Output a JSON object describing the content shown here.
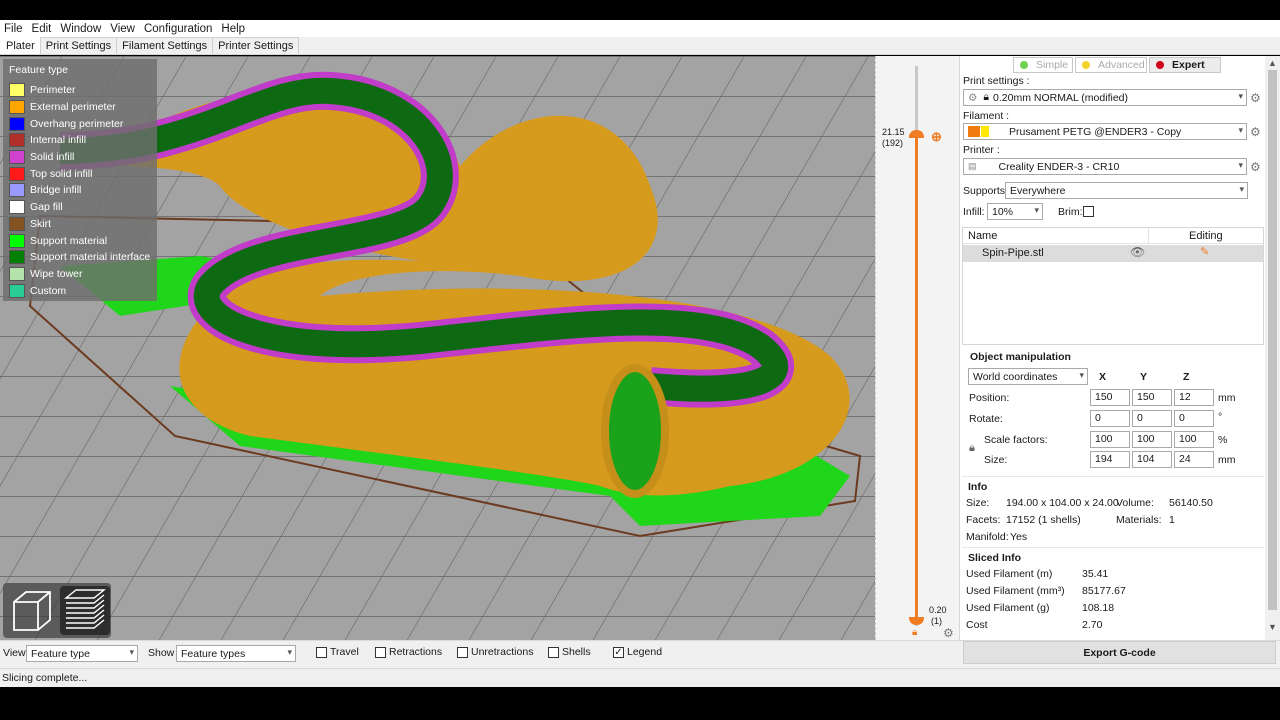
{
  "menu": [
    "File",
    "Edit",
    "Window",
    "View",
    "Configuration",
    "Help"
  ],
  "tabs": [
    "Plater",
    "Print Settings",
    "Filament Settings",
    "Printer Settings"
  ],
  "legend": {
    "title": "Feature type",
    "items": [
      {
        "label": "Perimeter",
        "color": "#ffff66"
      },
      {
        "label": "External perimeter",
        "color": "#ffa500"
      },
      {
        "label": "Overhang perimeter",
        "color": "#0000ff"
      },
      {
        "label": "Internal infill",
        "color": "#b03029"
      },
      {
        "label": "Solid infill",
        "color": "#d041d0"
      },
      {
        "label": "Top solid infill",
        "color": "#ff1a1a"
      },
      {
        "label": "Bridge infill",
        "color": "#9999ff"
      },
      {
        "label": "Gap fill",
        "color": "#ffffff"
      },
      {
        "label": "Skirt",
        "color": "#845321"
      },
      {
        "label": "Support material",
        "color": "#00ff00"
      },
      {
        "label": "Support material interface",
        "color": "#008000"
      },
      {
        "label": "Wipe tower",
        "color": "#b3e3ab"
      },
      {
        "label": "Custom",
        "color": "#28cc94"
      }
    ]
  },
  "slider": {
    "top_value": "21.15",
    "top_layer": "(192)",
    "bottom_value": "0.20",
    "bottom_layer": "(1)"
  },
  "modes": [
    {
      "label": "Simple",
      "color": "#6fd24e"
    },
    {
      "label": "Advanced",
      "color": "#f2d32c"
    },
    {
      "label": "Expert",
      "color": "#d2001a"
    }
  ],
  "print_settings": {
    "label": "Print settings :",
    "value": "0.20mm NORMAL (modified)"
  },
  "filament": {
    "label": "Filament :",
    "value": "Prusament PETG @ENDER3 - Copy"
  },
  "printer": {
    "label": "Printer :",
    "value": "Creality ENDER-3 - CR10"
  },
  "supports": {
    "label": "Supports:",
    "value": "Everywhere"
  },
  "infill": {
    "label": "Infill:",
    "value": "10%"
  },
  "brim": {
    "label": "Brim:"
  },
  "object_list": {
    "col_name": "Name",
    "col_editing": "Editing",
    "items": [
      "Spin-Pipe.stl"
    ]
  },
  "object_manipulation": {
    "title": "Object manipulation",
    "coords": "World coordinates",
    "axes": [
      "X",
      "Y",
      "Z"
    ],
    "position": {
      "label": "Position:",
      "values": [
        "150",
        "150",
        "12"
      ],
      "unit": "mm"
    },
    "rotate": {
      "label": "Rotate:",
      "values": [
        "0",
        "0",
        "0"
      ],
      "unit": "°"
    },
    "scale": {
      "label": "Scale factors:",
      "values": [
        "100",
        "100",
        "100"
      ],
      "unit": "%"
    },
    "size": {
      "label": "Size:",
      "values": [
        "194",
        "104",
        "24"
      ],
      "unit": "mm"
    }
  },
  "info": {
    "title": "Info",
    "size_label": "Size:",
    "size_value": "194.00 x 104.00 x 24.00",
    "volume_label": "Volume:",
    "volume_value": "56140.50",
    "facets_label": "Facets:",
    "facets_value": "17152 (1 shells)",
    "materials_label": "Materials:",
    "materials_value": "1",
    "manifold_label": "Manifold:",
    "manifold_value": "Yes"
  },
  "sliced_info": {
    "title": "Sliced Info",
    "rows": [
      {
        "label": "Used Filament (m)",
        "value": "35.41"
      },
      {
        "label": "Used Filament (mm³)",
        "value": "85177.67"
      },
      {
        "label": "Used Filament (g)",
        "value": "108.18"
      },
      {
        "label": "Cost",
        "value": "2.70"
      }
    ]
  },
  "bottom": {
    "view_label": "View",
    "view_value": "Feature type",
    "show_label": "Show",
    "show_value": "Feature types",
    "checks": [
      {
        "label": "Travel",
        "checked": false
      },
      {
        "label": "Retractions",
        "checked": false
      },
      {
        "label": "Unretractions",
        "checked": false
      },
      {
        "label": "Shells",
        "checked": false
      },
      {
        "label": "Legend",
        "checked": true
      }
    ]
  },
  "export_label": "Export G-code",
  "status": "Slicing complete..."
}
